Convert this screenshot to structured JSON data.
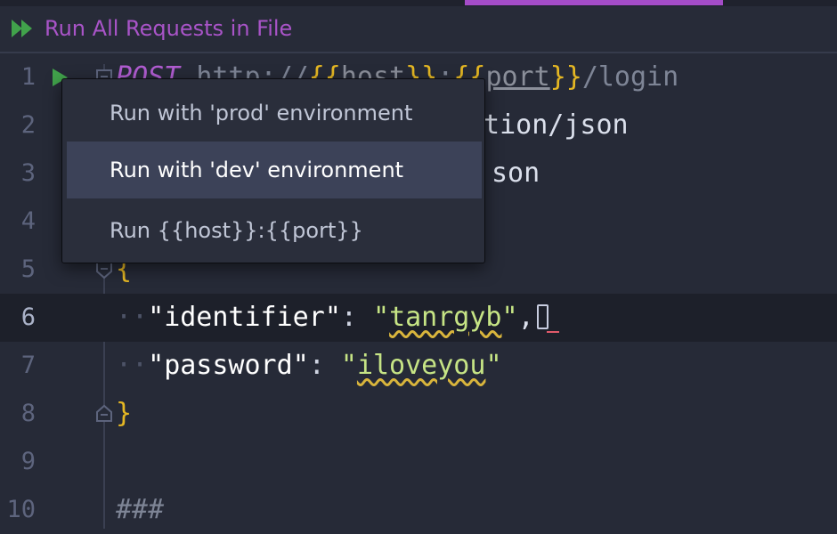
{
  "toolbar": {
    "run_all_label": "Run All Requests in File",
    "run_all_icon": "run-all-icon"
  },
  "colors": {
    "background": "#262a37",
    "accent": "#a954c8",
    "run_icon": "#41a24b",
    "selection": "#3c4258"
  },
  "editor": {
    "lines": [
      {
        "number": "1",
        "method": "POST",
        "url_prefix": "http://",
        "var1": "host",
        "sep": ":",
        "var2": "port",
        "path": "/login"
      },
      {
        "number": "2",
        "visible_text": "ntion/json"
      },
      {
        "number": "3",
        "visible_text": "son"
      },
      {
        "number": "4"
      },
      {
        "number": "5",
        "text": "{"
      },
      {
        "number": "6",
        "key": "identifier",
        "value": "tanrgyb",
        "trail": ","
      },
      {
        "number": "7",
        "key": "password",
        "value": "iloveyou"
      },
      {
        "number": "8",
        "text": "}"
      },
      {
        "number": "9"
      },
      {
        "number": "10",
        "text": "###"
      }
    ]
  },
  "popup": {
    "items": [
      {
        "label": "Run with 'prod' environment"
      },
      {
        "label": "Run with 'dev' environment",
        "selected": true
      },
      {
        "label": "Run {{host}}:{{port}}"
      }
    ]
  }
}
